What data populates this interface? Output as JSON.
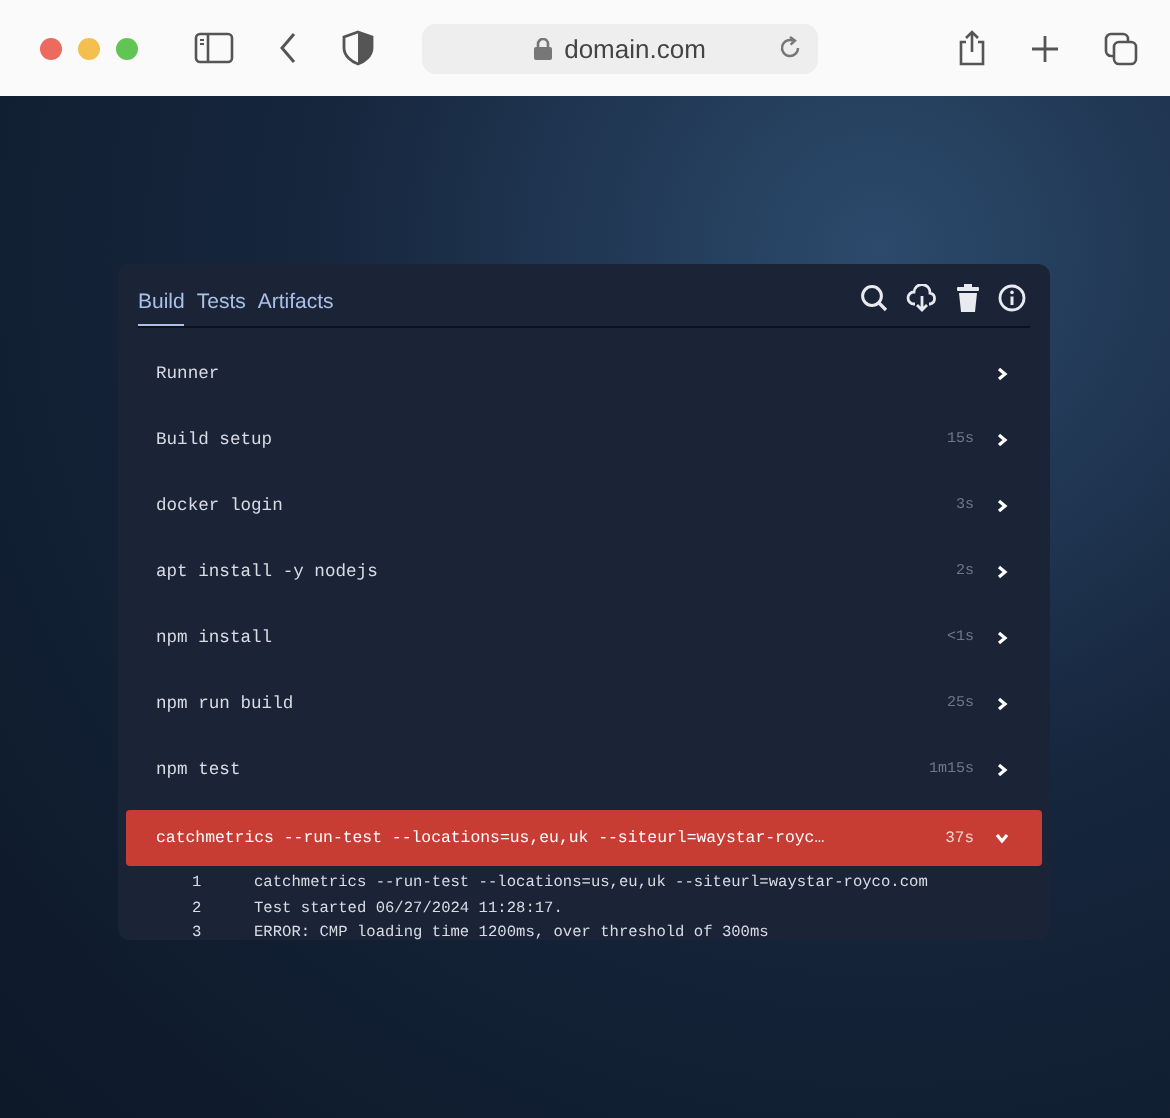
{
  "browser": {
    "url": "domain.com"
  },
  "tabs": [
    {
      "label": "Build",
      "selected": true
    },
    {
      "label": "Tests",
      "selected": false
    },
    {
      "label": "Artifacts",
      "selected": false
    }
  ],
  "steps": [
    {
      "label": "Runner",
      "failed": false,
      "expanded": false
    },
    {
      "label": "Build setup",
      "duration": "15s",
      "failed": false,
      "expanded": false
    },
    {
      "label": "docker login",
      "duration": "3s",
      "failed": false,
      "expanded": false
    },
    {
      "label": "apt install -y nodejs",
      "duration": "2s",
      "failed": false,
      "expanded": false
    },
    {
      "label": "npm install",
      "duration": "<1s",
      "failed": false,
      "expanded": false
    },
    {
      "label": "npm run build",
      "duration": "25s",
      "failed": false,
      "expanded": false
    },
    {
      "label": "npm test",
      "duration": "1m15s",
      "failed": false,
      "expanded": false
    },
    {
      "label": "catchmetrics --run-test --locations=us,eu,uk --siteurl=waystar-royc…",
      "duration": "37s",
      "failed": true,
      "expanded": true,
      "log": [
        {
          "number": "1",
          "text": "catchmetrics --run-test --locations=us,eu,uk --siteurl=waystar-royco.com"
        },
        {
          "number": "2",
          "text": "Test started 06/27/2024 11:28:17."
        },
        {
          "number": "3",
          "text": "ERROR: CMP loading time 1200ms, over threshold of 300ms"
        }
      ]
    }
  ]
}
